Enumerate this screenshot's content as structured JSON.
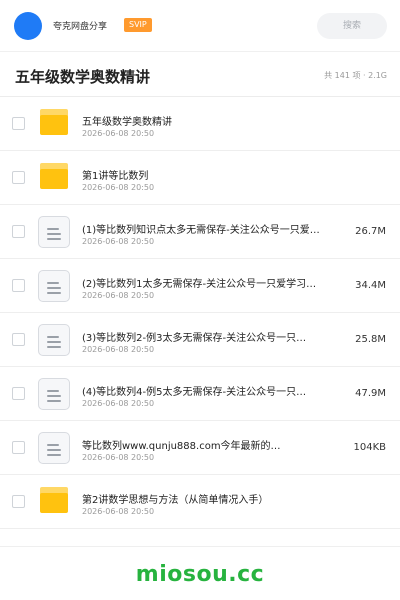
{
  "header": {
    "brand": "夸克网盘分享",
    "badge": "SVIP",
    "search_placeholder": "搜索"
  },
  "title_bar": {
    "title": "五年级数学奥数精讲",
    "meta": "共 141 项 · 2.1G"
  },
  "files": [
    {
      "type": "folder",
      "name": "五年级数学奥数精讲",
      "date": "2026-06-08 20:50",
      "size": ""
    },
    {
      "type": "folder",
      "name": "第1讲等比数列",
      "date": "2026-06-08 20:50",
      "size": ""
    },
    {
      "type": "doc",
      "name": "(1)等比数列知识点太多无需保存-关注公众号一只爱…",
      "date": "2026-06-08 20:50",
      "size": "26.7M"
    },
    {
      "type": "doc",
      "name": "(2)等比数列1太多无需保存-关注公众号一只爱学习…",
      "date": "2026-06-08 20:50",
      "size": "34.4M"
    },
    {
      "type": "doc",
      "name": "(3)等比数列2-例3太多无需保存-关注公众号一只…",
      "date": "2026-06-08 20:50",
      "size": "25.8M"
    },
    {
      "type": "doc",
      "name": "(4)等比数列4-例5太多无需保存-关注公众号一只…",
      "date": "2026-06-08 20:50",
      "size": "47.9M"
    },
    {
      "type": "doc",
      "name": "等比数列www.qunju888.com今年最新的…",
      "date": "2026-06-08 20:50",
      "size": "104KB"
    },
    {
      "type": "folder",
      "name": "第2讲数学思想与方法（从简单情况入手）",
      "date": "2026-06-08 20:50",
      "size": ""
    }
  ],
  "watermark": "miosou.cc",
  "colors": {
    "avatar": "#1f7bf6",
    "badge": "#ff9a2e",
    "folder": "#ffc20f",
    "watermark": "#27b33f"
  },
  "icons": {
    "folder": "folder-icon",
    "doc": "document-icon"
  }
}
